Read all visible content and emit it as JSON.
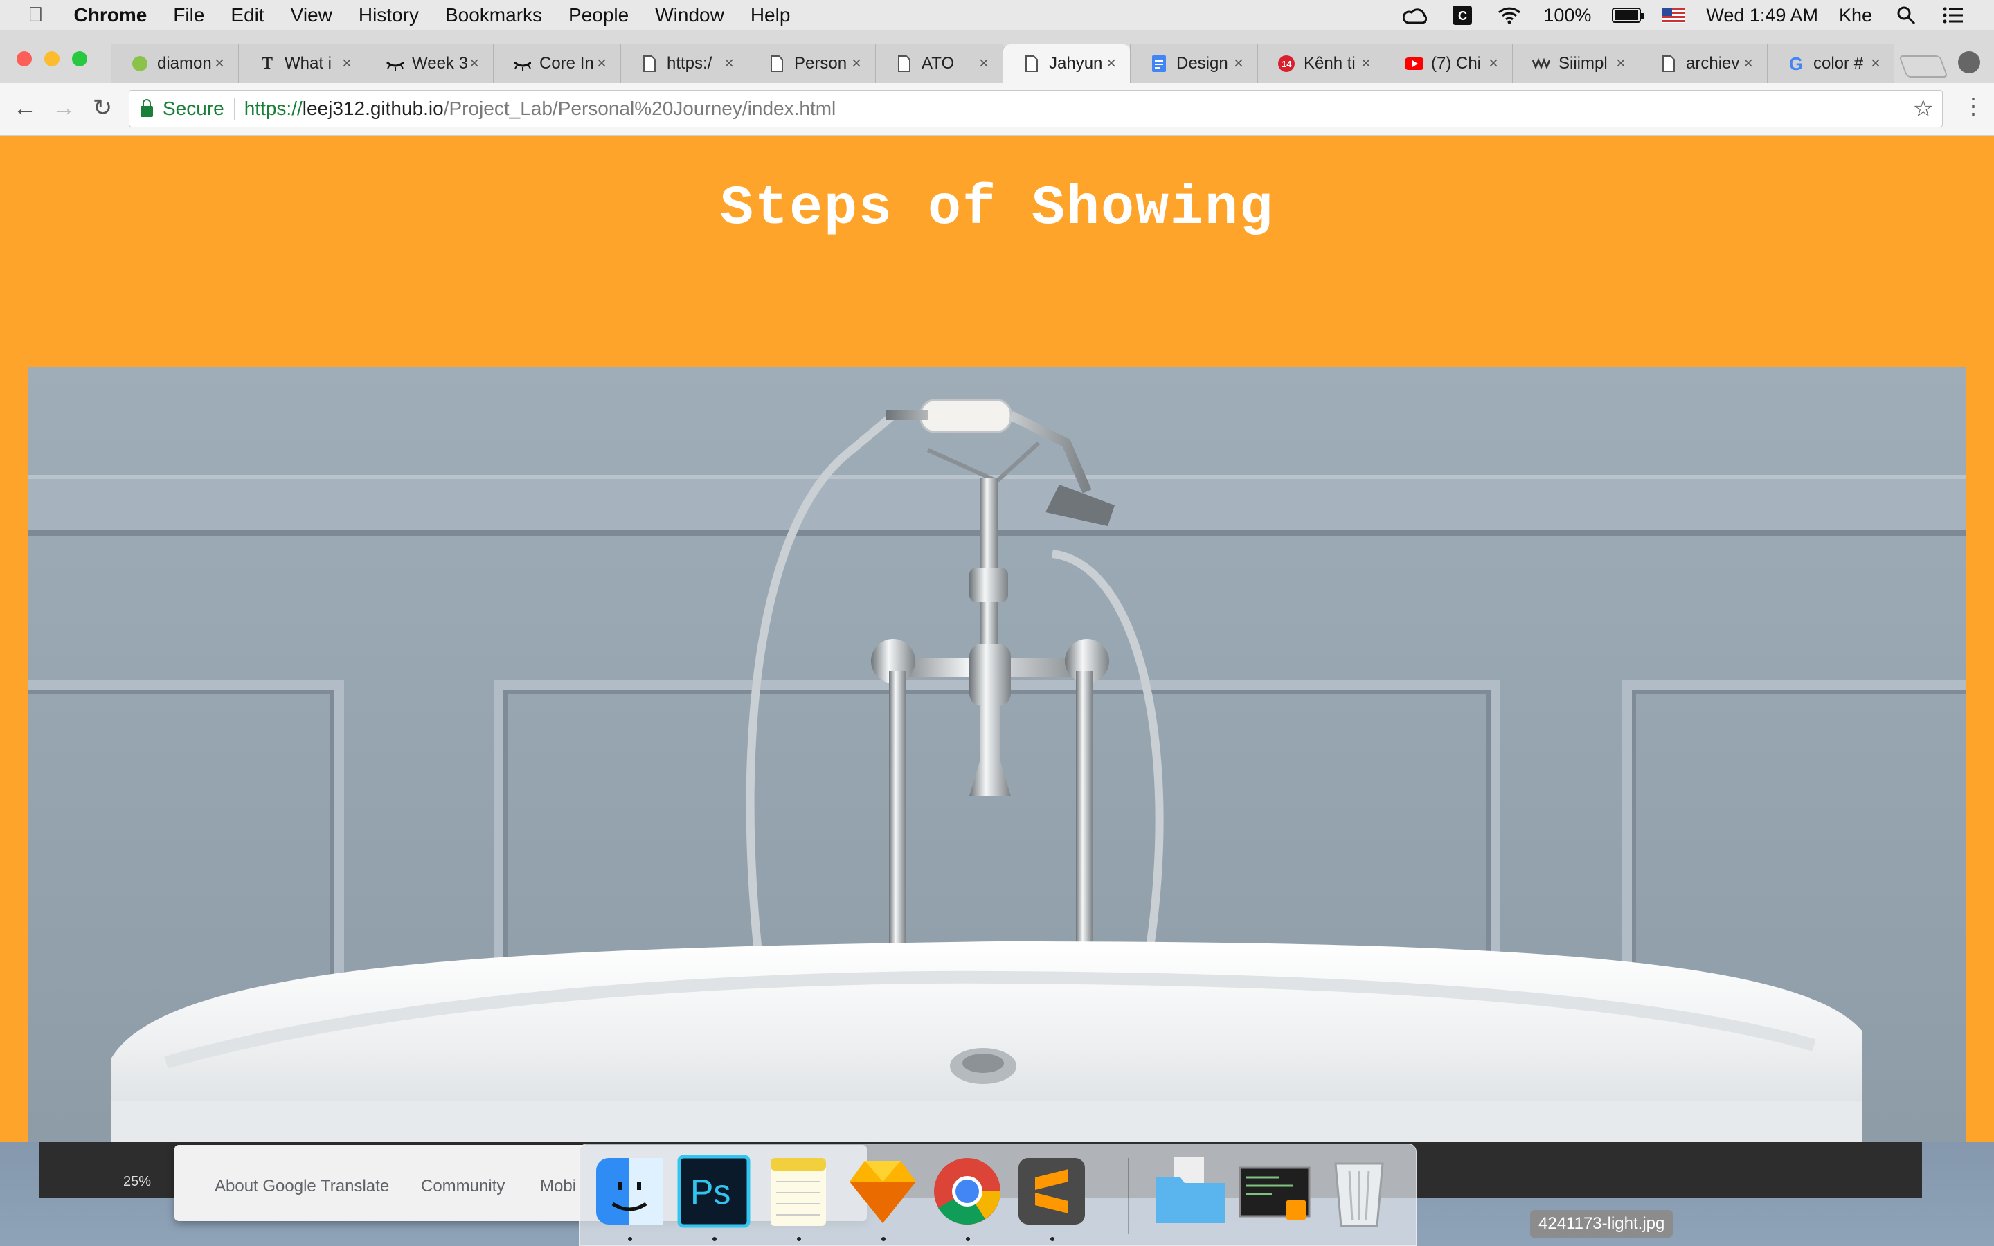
{
  "menubar": {
    "app_name": "Chrome",
    "menus": [
      "File",
      "Edit",
      "View",
      "History",
      "Bookmarks",
      "People",
      "Window",
      "Help"
    ],
    "battery": "100%",
    "clock": "Wed 1:49 AM",
    "user": "Khe"
  },
  "tabs": [
    {
      "label": "diamon",
      "icon": "leaf-icon"
    },
    {
      "label": "What i",
      "icon": "nyt-icon"
    },
    {
      "label": "Week 3",
      "icon": "eye-icon"
    },
    {
      "label": "Core In",
      "icon": "eye-icon"
    },
    {
      "label": "https:/",
      "icon": "page-icon"
    },
    {
      "label": "Person",
      "icon": "page-icon"
    },
    {
      "label": "ATO",
      "icon": "page-icon"
    },
    {
      "label": "Jahyun",
      "icon": "page-icon",
      "active": true
    },
    {
      "label": "Design",
      "icon": "docs-icon"
    },
    {
      "label": "Kênh ti",
      "icon": "badge-icon"
    },
    {
      "label": "(7) Chi",
      "icon": "youtube-icon"
    },
    {
      "label": "Siiimpl",
      "icon": "wave-icon"
    },
    {
      "label": "archiev",
      "icon": "page-icon"
    },
    {
      "label": "color #",
      "icon": "google-icon"
    }
  ],
  "tab_close": "×",
  "omnibox": {
    "secure_label": "Secure",
    "url_scheme": "https://",
    "url_host": "leej312.github.io",
    "url_path": "/Project_Lab/Personal%20Journey/index.html"
  },
  "page": {
    "title": "Steps of Showing",
    "background": "#ffa42a",
    "hero_image": "bathtub-faucet-photo"
  },
  "background_windows": {
    "zoom": "25%",
    "links": [
      "About Google Translate",
      "Community",
      "Mobi"
    ],
    "file_label": "4241173-light.jpg"
  },
  "dock": [
    "finder",
    "photoshop",
    "notes",
    "sketch",
    "chrome",
    "sublime-text",
    "folder",
    "terminal",
    "trash"
  ]
}
